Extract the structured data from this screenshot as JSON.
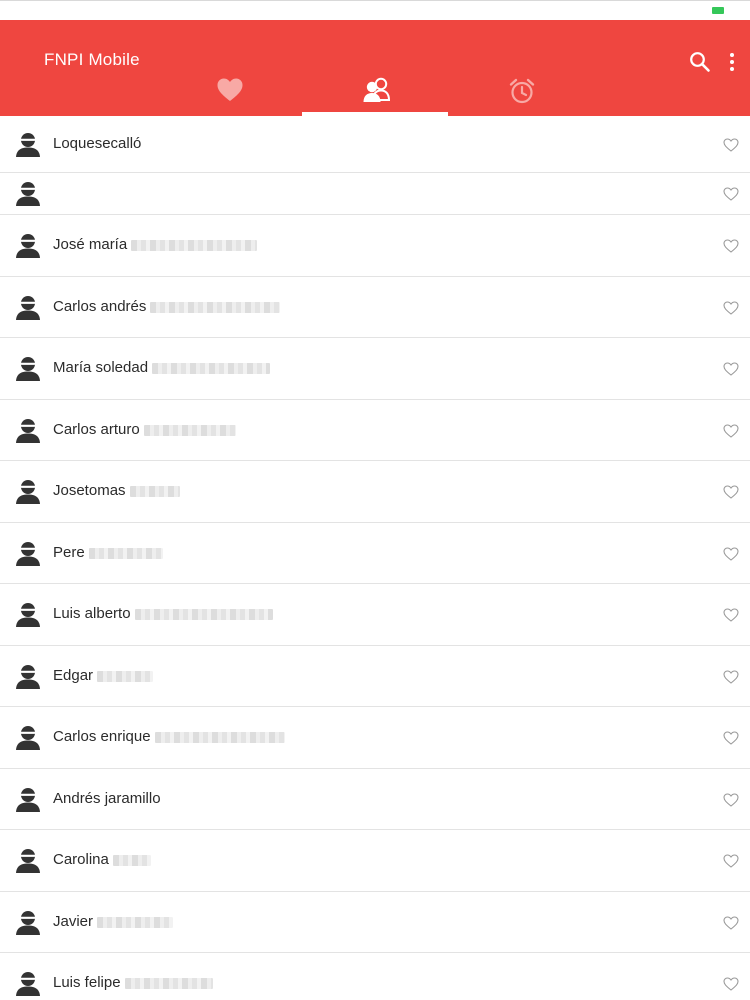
{
  "app": {
    "title": "FNPI Mobile"
  },
  "colors": {
    "primary": "#ef4640",
    "text": "#2b2b2b",
    "divider": "#e3e3e3",
    "battery": "#35c759"
  },
  "toolbar": {
    "search_icon": "search-icon",
    "more_icon": "more-vertical-icon"
  },
  "tabs": [
    {
      "icon": "heart-icon",
      "selected": false
    },
    {
      "icon": "people-icon",
      "selected": true
    },
    {
      "icon": "alarm-clock-icon",
      "selected": false
    }
  ],
  "contacts": [
    {
      "name": "Loquesecalló"
    },
    {
      "name": ""
    },
    {
      "name": "José maría"
    },
    {
      "name": "Carlos andrés"
    },
    {
      "name": "María soledad"
    },
    {
      "name": "Carlos arturo"
    },
    {
      "name": "Josetomas"
    },
    {
      "name": "Pere"
    },
    {
      "name": "Luis alberto"
    },
    {
      "name": "Edgar"
    },
    {
      "name": "Carlos enrique"
    },
    {
      "name": "Andrés jaramillo"
    },
    {
      "name": "Carolina"
    },
    {
      "name": "Javier"
    },
    {
      "name": "Luis felipe"
    }
  ]
}
